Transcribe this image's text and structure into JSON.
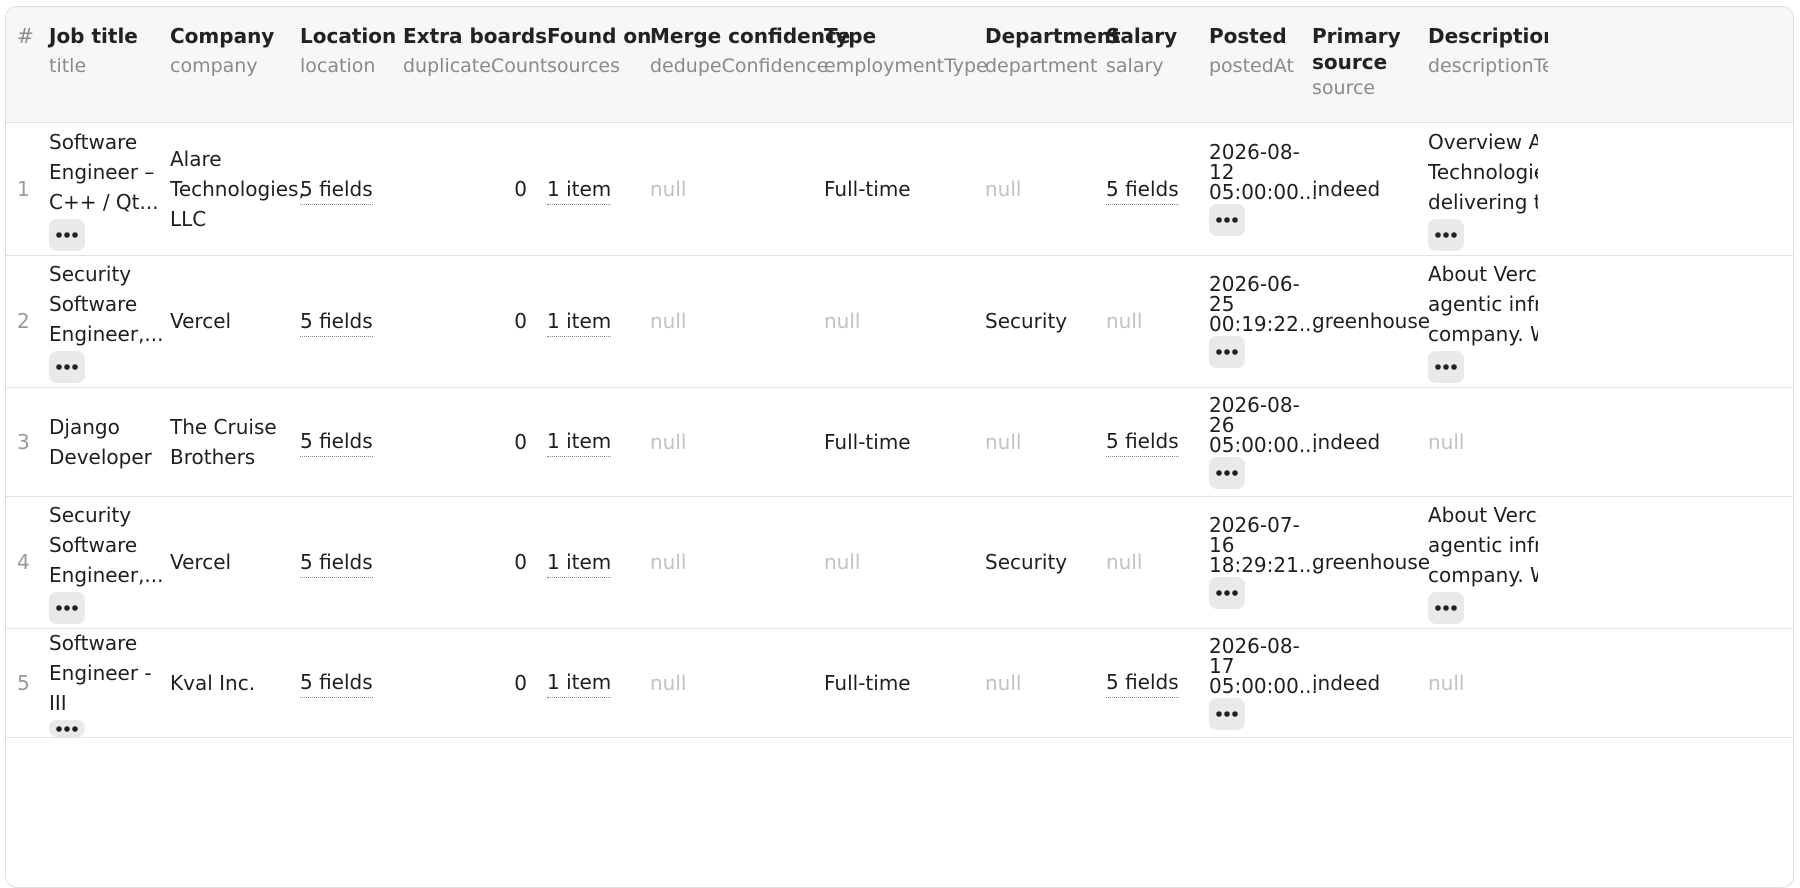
{
  "columns": [
    {
      "label": "#",
      "key": ""
    },
    {
      "label": "Job title",
      "key": "title"
    },
    {
      "label": "Company",
      "key": "company"
    },
    {
      "label": "Location",
      "key": "location"
    },
    {
      "label": "Extra boards",
      "key": "duplicateCount"
    },
    {
      "label": "Found on",
      "key": "sources"
    },
    {
      "label": "Merge confidence",
      "key": "dedupeConfidence"
    },
    {
      "label": "Type",
      "key": "employmentType"
    },
    {
      "label": "Department",
      "key": "department"
    },
    {
      "label": "Salary",
      "key": "salary"
    },
    {
      "label": "Posted",
      "key": "postedAt"
    },
    {
      "label_line1": "Primary",
      "label_line2": "source",
      "key": "source"
    },
    {
      "label": "Description",
      "key": "descriptionTe"
    }
  ],
  "rows": [
    {
      "num": "1",
      "title_lines": [
        "Software",
        "Engineer –",
        "C++ / Qt..."
      ],
      "company_lines": [
        "Alare",
        "Technologies,",
        "LLC"
      ],
      "location": "5 fields",
      "duplicateCount": "0",
      "sources": "1 item",
      "dedupeConfidence": "null",
      "employmentType": "Full-time",
      "department": "null",
      "salary": "5 fields",
      "posted_lines": [
        "2026-08-",
        "12",
        "05:00:00..."
      ],
      "source": "indeed",
      "desc_lines": [
        "Overview Alar",
        "Technologies",
        "delivering the"
      ]
    },
    {
      "num": "2",
      "title_lines": [
        "Security",
        "Software",
        "Engineer,..."
      ],
      "company_lines": [
        "Vercel"
      ],
      "location": "5 fields",
      "duplicateCount": "0",
      "sources": "1 item",
      "dedupeConfidence": "null",
      "employmentType": "null",
      "department": "Security",
      "salary": "null",
      "posted_lines": [
        "2026-06-",
        "25",
        "00:19:22..."
      ],
      "source": "greenhouse",
      "desc_lines": [
        "About Vercel:",
        "agentic infras",
        "company. We"
      ]
    },
    {
      "num": "3",
      "title_lines": [
        "Django",
        "Developer"
      ],
      "company_lines": [
        "The Cruise",
        "Brothers"
      ],
      "location": "5 fields",
      "duplicateCount": "0",
      "sources": "1 item",
      "dedupeConfidence": "null",
      "employmentType": "Full-time",
      "department": "null",
      "salary": "5 fields",
      "posted_lines": [
        "2026-08-",
        "26",
        "05:00:00..."
      ],
      "source": "indeed",
      "desc_lines": [
        "null"
      ]
    },
    {
      "num": "4",
      "title_lines": [
        "Security",
        "Software",
        "Engineer,..."
      ],
      "company_lines": [
        "Vercel"
      ],
      "location": "5 fields",
      "duplicateCount": "0",
      "sources": "1 item",
      "dedupeConfidence": "null",
      "employmentType": "null",
      "department": "Security",
      "salary": "null",
      "posted_lines": [
        "2026-07-",
        "16",
        "18:29:21..."
      ],
      "source": "greenhouse",
      "desc_lines": [
        "About Vercel:",
        "agentic infras",
        "company. We"
      ]
    },
    {
      "num": "5",
      "title_lines": [
        "Software",
        "Engineer -",
        "III"
      ],
      "company_lines": [
        "Kval Inc."
      ],
      "location": "5 fields",
      "duplicateCount": "0",
      "sources": "1 item",
      "dedupeConfidence": "null",
      "employmentType": "Full-time",
      "department": "null",
      "salary": "5 fields",
      "posted_lines": [
        "2026-08-",
        "17",
        "05:00:00..."
      ],
      "source": "indeed",
      "desc_lines": [
        "null"
      ]
    }
  ],
  "icons": {
    "expand": "more-horizontal-icon"
  },
  "colors": {
    "null_text": "#c2c2c2",
    "header_bg": "#f7f7f7",
    "border": "#e2e2e2"
  }
}
